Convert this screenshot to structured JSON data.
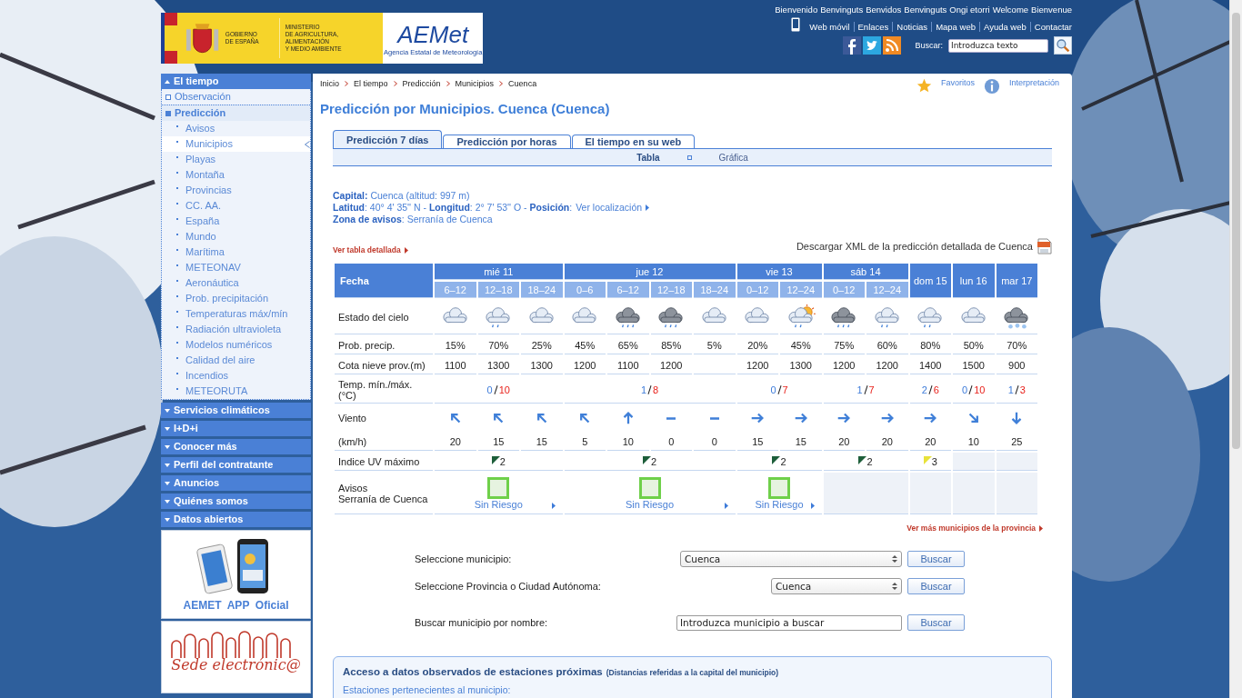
{
  "header": {
    "gov_lines": "GOBIERNO\nDE ESPAÑA",
    "ministry_lines": "MINISTERIO\nDE AGRICULTURA, ALIMENTACIÓN\nY MEDIO AMBIENTE",
    "agency_logo": "AEMet",
    "agency_name": "Agencia Estatal de Meteorología",
    "welcome": [
      "Bienvenido",
      "Benvinguts",
      "Benvidos",
      "Benvinguts",
      "Ongi etorri",
      "Welcome",
      "Bienvenue"
    ],
    "links": [
      "Web móvil",
      "Enlaces",
      "Noticias",
      "Mapa web",
      "Ayuda web",
      "Contactar"
    ],
    "search_label": "Buscar:",
    "search_placeholder": "Introduzca texto"
  },
  "sidebar": [
    {
      "label": "El tiempo",
      "expanded": true,
      "children": [
        {
          "label": "Observación",
          "expanded": false
        },
        {
          "label": "Predicción",
          "expanded": true,
          "children": [
            {
              "label": "Avisos",
              "selected": false
            },
            {
              "label": "Municipios",
              "selected": true
            },
            {
              "label": "Playas",
              "selected": false
            },
            {
              "label": "Montaña",
              "selected": false
            },
            {
              "label": "Provincias",
              "selected": false
            },
            {
              "label": "CC. AA.",
              "selected": false
            },
            {
              "label": "España",
              "selected": false
            },
            {
              "label": "Mundo",
              "selected": false
            },
            {
              "label": "Marítima",
              "selected": false
            },
            {
              "label": "METEONAV",
              "selected": false
            },
            {
              "label": "Aeronáutica",
              "selected": false
            },
            {
              "label": "Prob. precipitación",
              "selected": false
            },
            {
              "label": "Temperaturas máx/mín",
              "selected": false
            },
            {
              "label": "Radiación ultravioleta",
              "selected": false
            },
            {
              "label": "Modelos numéricos",
              "selected": false
            },
            {
              "label": "Calidad del aire",
              "selected": false
            },
            {
              "label": "Incendios",
              "selected": false
            },
            {
              "label": "METEORUTA",
              "selected": false
            }
          ]
        }
      ]
    },
    {
      "label": "Servicios climáticos",
      "expanded": false
    },
    {
      "label": "I+D+i",
      "expanded": false
    },
    {
      "label": "Conocer más",
      "expanded": false
    },
    {
      "label": "Perfil del contratante",
      "expanded": false
    },
    {
      "label": "Anuncios",
      "expanded": false
    },
    {
      "label": "Quiénes somos",
      "expanded": false
    },
    {
      "label": "Datos abiertos",
      "expanded": false
    }
  ],
  "app_promo": "AEMET  APP  Oficial",
  "sede": "Sede electrónic@",
  "breadcrumb": [
    "Inicio",
    "El tiempo",
    "Predicción",
    "Municipios",
    "Cuenca"
  ],
  "tools": [
    "Favoritos",
    "Interpretación"
  ],
  "title": "Predicción por Municipios. Cuenca (Cuenca)",
  "tabs": [
    {
      "label": "Predicción 7 días",
      "selected": true
    },
    {
      "label": "Predicción por horas",
      "selected": false
    },
    {
      "label": "El tiempo en su web",
      "selected": false
    }
  ],
  "subtabs": [
    {
      "label": "Tabla",
      "selected": true
    },
    {
      "label": "Gráfica",
      "selected": false
    }
  ],
  "info": {
    "capital": "**Capital:** Cuenca (altitud: 997 m)",
    "coords": "**Latitud**: 40° 4' 35'' N - **Longitud**: 2° 7' 53'' O - **Posición**:",
    "location_link": "Ver localización",
    "zone": "**Zona de avisos**: Serranía de Cuenca"
  },
  "detail_link": "Ver tabla detallada",
  "xml_link": "Descargar XML de la predicción detallada de Cuenca",
  "table": {
    "labels": {
      "date": "Fecha",
      "sky": "Estado del cielo",
      "precip": "Prob. precip.",
      "snow": "Cota nieve prov.(m)",
      "temp": "Temp. mín./máx. (°C)",
      "wind": "Viento",
      "wind_unit": "(km/h)",
      "uv": "Indice UV máximo",
      "warnings": "Avisos\nSerranía de Cuenca"
    },
    "days": [
      {
        "label": "mié 11",
        "temp_min": "0",
        "temp_max": "10",
        "uv": {
          "value": "2",
          "color": "#1d5e3a"
        },
        "warning": {
          "text": "Sin Riesgo",
          "color": "#6fd04a"
        },
        "periods": [
          {
            "label": "6–12",
            "sky": {
              "kind": "cloud"
            },
            "precip": "15%",
            "snow": "1100",
            "wind": {
              "kind": "up_left",
              "speed": "20"
            }
          },
          {
            "label": "12–18",
            "sky": {
              "kind": "cloud_rain"
            },
            "precip": "70%",
            "snow": "1300",
            "wind": {
              "kind": "up_left",
              "speed": "15"
            }
          },
          {
            "label": "18–24",
            "sky": {
              "kind": "cloud"
            },
            "precip": "25%",
            "snow": "1300",
            "wind": {
              "kind": "up_left",
              "speed": "15"
            }
          }
        ]
      },
      {
        "label": "jue 12",
        "temp_min": "1",
        "temp_max": "8",
        "uv": {
          "value": "2",
          "color": "#1d5e3a"
        },
        "warning": {
          "text": "Sin Riesgo",
          "color": "#6fd04a"
        },
        "periods": [
          {
            "label": "0–6",
            "sky": {
              "kind": "cloud"
            },
            "precip": "45%",
            "snow": "1200",
            "wind": {
              "kind": "up_left",
              "speed": "5"
            }
          },
          {
            "label": "6–12",
            "sky": {
              "kind": "dark_rain"
            },
            "precip": "65%",
            "snow": "1100",
            "wind": {
              "kind": "up",
              "speed": "10"
            }
          },
          {
            "label": "12–18",
            "sky": {
              "kind": "dark_rain"
            },
            "precip": "85%",
            "snow": "1200",
            "wind": {
              "kind": "calm",
              "speed": "0"
            }
          },
          {
            "label": "18–24",
            "sky": {
              "kind": "cloud"
            },
            "precip": "5%",
            "wind": {
              "kind": "calm",
              "speed": "0"
            }
          }
        ]
      },
      {
        "label": "vie 13",
        "temp_min": "0",
        "temp_max": "7",
        "uv": {
          "value": "2",
          "color": "#1d5e3a"
        },
        "warning": {
          "text": "Sin Riesgo",
          "color": "#6fd04a"
        },
        "periods": [
          {
            "label": "0–12",
            "sky": {
              "kind": "cloud"
            },
            "precip": "20%",
            "snow": "1200",
            "wind": {
              "kind": "right",
              "speed": "15"
            }
          },
          {
            "label": "12–24",
            "sky": {
              "kind": "sun_rain"
            },
            "precip": "45%",
            "snow": "1300",
            "wind": {
              "kind": "right",
              "speed": "15"
            }
          }
        ]
      },
      {
        "label": "sáb 14",
        "temp_min": "1",
        "temp_max": "7",
        "uv": {
          "value": "2",
          "color": "#1d5e3a"
        },
        "periods": [
          {
            "label": "0–12",
            "sky": {
              "kind": "dark_rain"
            },
            "precip": "75%",
            "snow": "1200",
            "wind": {
              "kind": "right",
              "speed": "20"
            }
          },
          {
            "label": "12–24",
            "sky": {
              "kind": "cloud_rain"
            },
            "precip": "60%",
            "snow": "1200",
            "wind": {
              "kind": "right",
              "speed": "20"
            }
          }
        ]
      },
      {
        "label": "dom 15",
        "temp_min": "2",
        "temp_max": "6",
        "uv": {
          "value": "3",
          "color": "#e8e23a"
        },
        "periods": [
          {
            "sky": {
              "kind": "cloud_rain"
            },
            "precip": "80%",
            "snow": "1400",
            "wind": {
              "kind": "right",
              "speed": "20"
            }
          }
        ]
      },
      {
        "label": "lun 16",
        "temp_min": "0",
        "temp_max": "10",
        "periods": [
          {
            "sky": {
              "kind": "cloud"
            },
            "precip": "50%",
            "snow": "1500",
            "wind": {
              "kind": "down_right",
              "speed": "10"
            }
          }
        ]
      },
      {
        "label": "mar 17",
        "temp_min": "1",
        "temp_max": "3",
        "periods": [
          {
            "sky": {
              "kind": "dark_snow"
            },
            "precip": "70%",
            "snow": "900",
            "wind": {
              "kind": "down",
              "speed": "25"
            }
          }
        ]
      }
    ]
  },
  "more_link": "Ver más municipios de la provincia",
  "search_form": [
    {
      "label": "Seleccione municipio:",
      "kind": "select",
      "value": "Cuenca",
      "button": "Buscar"
    },
    {
      "label": "Seleccione Provincia o Ciudad Autónoma:",
      "kind": "select",
      "value": "Cuenca",
      "button": "Buscar"
    },
    {
      "label": "Buscar municipio por nombre:",
      "kind": "input",
      "placeholder": "Introduzca municipio a buscar",
      "button": "Buscar"
    }
  ],
  "stations": {
    "title": "Acceso a datos observados de estaciones próximas",
    "note": "(Distancias referidas a la capital del municipio)",
    "subtitle": "Estaciones pertenecientes al municipio:"
  }
}
